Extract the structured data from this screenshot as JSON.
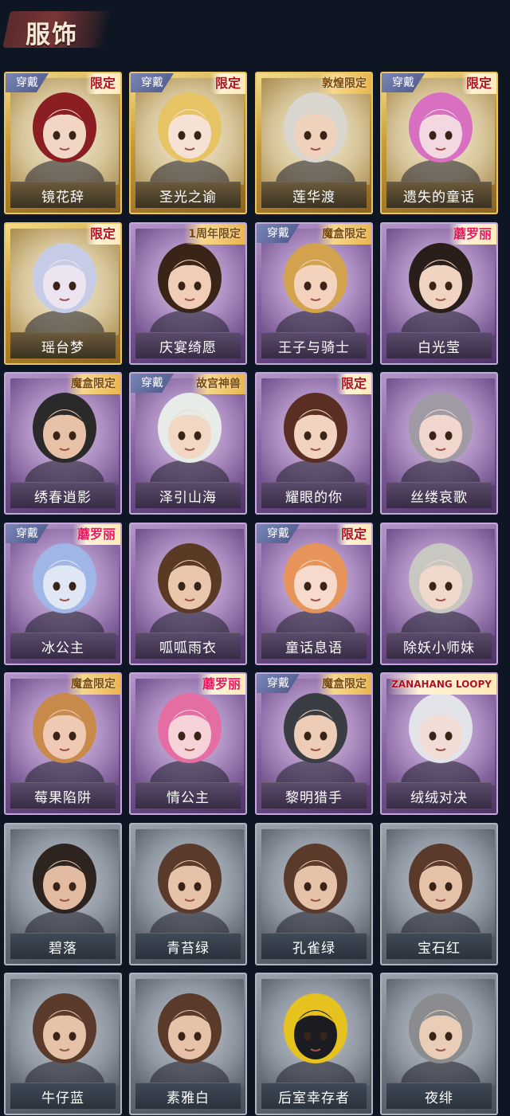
{
  "section": {
    "title": "服饰"
  },
  "tier_colors": {
    "gold": "#c99a35",
    "purple": "#7f5a9a",
    "gray": "#69717d"
  },
  "worn_label": "穿戴",
  "costumes": [
    {
      "name": "镜花辞",
      "tier": "gold",
      "badge": "限定",
      "worn": true,
      "hair": "#8b1e22",
      "skin": "#f1d6c6"
    },
    {
      "name": "圣光之谕",
      "tier": "gold",
      "badge": "限定",
      "worn": true,
      "hair": "#e6c464",
      "skin": "#f6e2d4"
    },
    {
      "name": "莲华渡",
      "tier": "gold",
      "badge": "敦煌限定",
      "worn": false,
      "hair": "#d9d6d0",
      "skin": "#efd2bc"
    },
    {
      "name": "遗失的童话",
      "tier": "gold",
      "badge": "限定",
      "worn": true,
      "hair": "#d86fc0",
      "skin": "#f3d7e1"
    },
    {
      "name": "瑶台梦",
      "tier": "gold",
      "badge": "限定",
      "worn": false,
      "hair": "#c7cce6",
      "skin": "#ece4f0"
    },
    {
      "name": "庆宴绮愿",
      "tier": "purple",
      "badge": "1周年限定",
      "worn": false,
      "hair": "#3a2418",
      "skin": "#f0cdb6"
    },
    {
      "name": "王子与骑士",
      "tier": "purple",
      "badge": "魔盒限定",
      "worn": true,
      "hair": "#d2a24e",
      "skin": "#f3d3bd"
    },
    {
      "name": "白光莹",
      "tier": "purple",
      "badge": "蘑罗丽",
      "worn": false,
      "hair": "#2a1e1a",
      "skin": "#f1d3c2"
    },
    {
      "name": "绣春逍影",
      "tier": "purple",
      "badge": "魔盒限定",
      "worn": false,
      "hair": "#2b2a2a",
      "skin": "#e8c2a6"
    },
    {
      "name": "泽引山海",
      "tier": "purple",
      "badge": "故宫神兽",
      "worn": true,
      "hair": "#e7ece8",
      "skin": "#f1d7c4"
    },
    {
      "name": "耀眼的你",
      "tier": "purple",
      "badge": "限定",
      "worn": false,
      "hair": "#5a2e22",
      "skin": "#f2d2c1"
    },
    {
      "name": "丝缕哀歌",
      "tier": "purple",
      "badge": "",
      "worn": false,
      "hair": "#9f9aa3",
      "skin": "#f0d6cd"
    },
    {
      "name": "冰公主",
      "tier": "purple",
      "badge": "蘑罗丽",
      "worn": true,
      "hair": "#9fb6e6",
      "skin": "#dfe6f4"
    },
    {
      "name": "呱呱雨衣",
      "tier": "purple",
      "badge": "",
      "worn": false,
      "hair": "#5a3a24",
      "skin": "#e9c6ac"
    },
    {
      "name": "童话息语",
      "tier": "purple",
      "badge": "限定",
      "worn": true,
      "hair": "#e7945a",
      "skin": "#f6dacb"
    },
    {
      "name": "除妖小师妹",
      "tier": "purple",
      "badge": "",
      "worn": false,
      "hair": "#c9c7c2",
      "skin": "#efd8cc"
    },
    {
      "name": "莓果陷阱",
      "tier": "purple",
      "badge": "魔盒限定",
      "worn": false,
      "hair": "#c88a4a",
      "skin": "#efc9b3"
    },
    {
      "name": "情公主",
      "tier": "purple",
      "badge": "蘑罗丽",
      "worn": false,
      "hair": "#e46ea3",
      "skin": "#f5d3d9"
    },
    {
      "name": "黎明猎手",
      "tier": "purple",
      "badge": "魔盒限定",
      "worn": true,
      "hair": "#3b3d45",
      "skin": "#edcdb7"
    },
    {
      "name": "绒绒对决",
      "tier": "purple",
      "badge": "ZANAHANG LOOPY",
      "worn": false,
      "hair": "#e3e3ea",
      "skin": "#f2dcd6"
    },
    {
      "name": "碧落",
      "tier": "gray",
      "badge": "",
      "worn": false,
      "hair": "#2d2420",
      "skin": "#e2bba0"
    },
    {
      "name": "青苔绿",
      "tier": "gray",
      "badge": "",
      "worn": false,
      "hair": "#5a3a2a",
      "skin": "#e6c2a8"
    },
    {
      "name": "孔雀绿",
      "tier": "gray",
      "badge": "",
      "worn": false,
      "hair": "#5a3a2a",
      "skin": "#e6c2a8"
    },
    {
      "name": "宝石红",
      "tier": "gray",
      "badge": "",
      "worn": false,
      "hair": "#5a3a2a",
      "skin": "#e6c2a8"
    },
    {
      "name": "牛仔蓝",
      "tier": "gray",
      "badge": "",
      "worn": false,
      "hair": "#5a3a2a",
      "skin": "#e6c2a8"
    },
    {
      "name": "素雅白",
      "tier": "gray",
      "badge": "",
      "worn": false,
      "hair": "#5a3a2a",
      "skin": "#e6c2a8"
    },
    {
      "name": "后室幸存者",
      "tier": "gray",
      "badge": "",
      "worn": false,
      "hair": "#e6c21e",
      "skin": "#1b1c22"
    },
    {
      "name": "夜绯",
      "tier": "gray",
      "badge": "",
      "worn": false,
      "hair": "#8a8c90",
      "skin": "#e9cdb7"
    }
  ]
}
